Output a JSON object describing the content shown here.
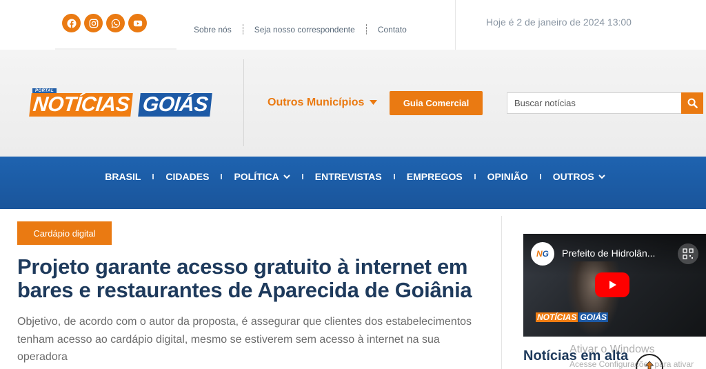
{
  "topbar": {
    "social": [
      {
        "name": "facebook-icon"
      },
      {
        "name": "instagram-icon"
      },
      {
        "name": "whatsapp-icon"
      },
      {
        "name": "youtube-icon"
      }
    ],
    "links": [
      "Sobre nós",
      "Seja nosso correspondente",
      "Contato"
    ],
    "date": "Hoje é 2 de janeiro de 2024 13:00"
  },
  "header": {
    "logo": {
      "portal": "PORTAL",
      "word1": "NOTÍCIAS",
      "word2": "GOIÁS"
    },
    "outros_municipios": "Outros Municípios",
    "guia_comercial": "Guia Comercial",
    "search_placeholder": "Buscar notícias"
  },
  "nav": {
    "items": [
      "BRASIL",
      "CIDADES",
      "POLÍTICA",
      "ENTREVISTAS",
      "EMPREGOS",
      "OPINIÃO",
      "OUTROS"
    ]
  },
  "article": {
    "category": "Cardápio digital",
    "title": "Projeto garante acesso gratuito à internet em bares e restaurantes de Aparecida de Goiânia",
    "lede": "Objetivo, de acordo com o autor da proposta, é assegurar que clientes dos estabelecimentos tenham acesso ao cardápio digital, mesmo se estiverem sem acesso à internet na sua operadora"
  },
  "sidebar": {
    "video": {
      "channel_n": "N",
      "channel_g": "G",
      "title": "Prefeito de Hidrolân...",
      "brand_word1": "NOTÍCIAS",
      "brand_word2": "GOIÁS"
    },
    "trending_title": "Notícias em alta"
  },
  "windows_watermark": {
    "line1": "Ativar o Windows",
    "line2": "Acesse Configurações para ativar"
  },
  "colors": {
    "accent": "#ea7a12",
    "nav_blue": "#1e63b0",
    "headline": "#1e3a5c"
  }
}
